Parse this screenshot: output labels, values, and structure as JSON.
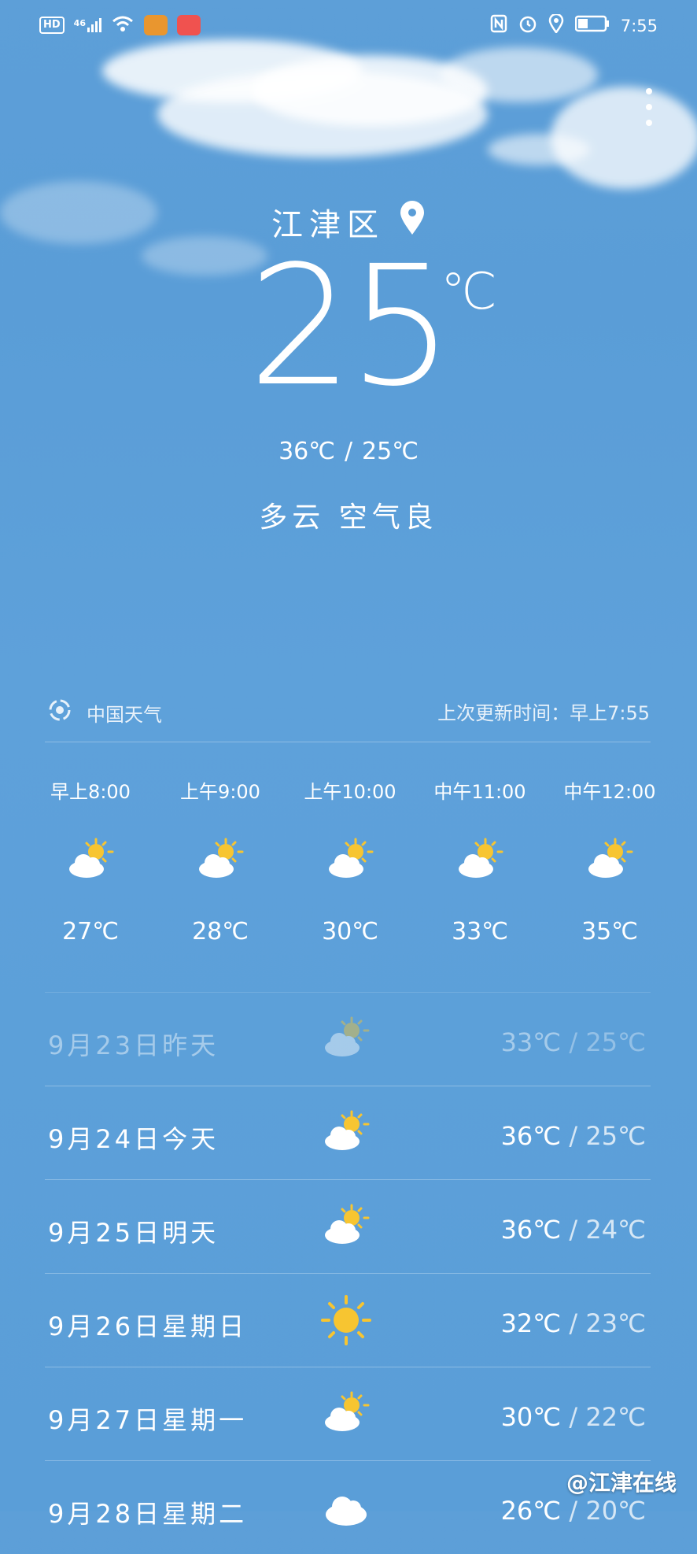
{
  "status_bar": {
    "left_badges": [
      "HD",
      "46"
    ],
    "time": "7:55",
    "icons": [
      "hd-icon",
      "signal-icon",
      "wifi-icon",
      "app-notification-icon",
      "app-notification-icon",
      "nfc-icon",
      "alarm-icon",
      "location-icon",
      "battery-icon"
    ]
  },
  "current": {
    "city": "江津区",
    "temp": "25",
    "unit": "℃",
    "high": "36℃",
    "low": "25℃",
    "range_sep": "/",
    "condition": "多云 空气良"
  },
  "source": {
    "name": "中国天气",
    "updated": "上次更新时间：早上7:55"
  },
  "hourly": [
    {
      "label": "早上8:00",
      "temp": "27℃",
      "icon": "partly-cloudy-icon"
    },
    {
      "label": "上午9:00",
      "temp": "28℃",
      "icon": "partly-cloudy-icon"
    },
    {
      "label": "上午10:00",
      "temp": "30℃",
      "icon": "partly-cloudy-icon"
    },
    {
      "label": "中午11:00",
      "temp": "33℃",
      "icon": "partly-cloudy-icon"
    },
    {
      "label": "中午12:00",
      "temp": "35℃",
      "icon": "partly-cloudy-icon"
    }
  ],
  "daily": [
    {
      "label": "9月23日昨天",
      "high": "33℃",
      "low": "25℃",
      "icon": "partly-cloudy-icon"
    },
    {
      "label": "9月24日今天",
      "high": "36℃",
      "low": "25℃",
      "icon": "partly-cloudy-icon"
    },
    {
      "label": "9月25日明天",
      "high": "36℃",
      "low": "24℃",
      "icon": "partly-cloudy-icon"
    },
    {
      "label": "9月26日星期日",
      "high": "32℃",
      "low": "23℃",
      "icon": "sunny-icon"
    },
    {
      "label": "9月27日星期一",
      "high": "30℃",
      "low": "22℃",
      "icon": "partly-cloudy-icon"
    },
    {
      "label": "9月28日星期二",
      "high": "26℃",
      "low": "20℃",
      "icon": "cloudy-icon"
    }
  ],
  "watermark": "@江津在线",
  "colors": {
    "sky": "#5a9dd7",
    "sun": "#f7c531",
    "cloud": "#ffffff"
  }
}
